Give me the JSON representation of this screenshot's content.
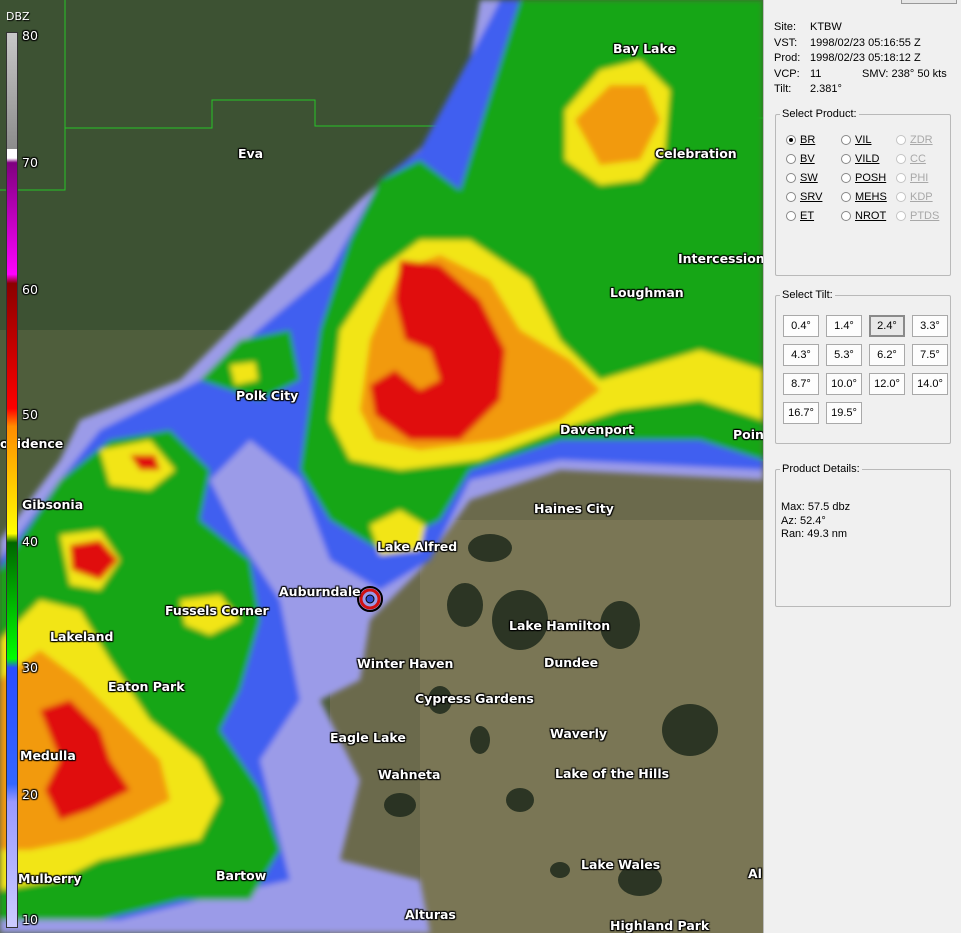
{
  "map": {
    "cities": [
      {
        "name": "Bay Lake"
      },
      {
        "name": "Eva"
      },
      {
        "name": "Celebration"
      },
      {
        "name": "Intercession C"
      },
      {
        "name": "Loughman"
      },
      {
        "name": "Polk City"
      },
      {
        "name": "Davenport"
      },
      {
        "name": "Poin"
      },
      {
        "name": "ovidence"
      },
      {
        "name": "Gibsonia"
      },
      {
        "name": "Haines City"
      },
      {
        "name": "Lake Alfred"
      },
      {
        "name": "Auburndale"
      },
      {
        "name": "Fussels Corner"
      },
      {
        "name": "Lake Hamilton"
      },
      {
        "name": "Lakeland"
      },
      {
        "name": "Winter Haven"
      },
      {
        "name": "Dundee"
      },
      {
        "name": "Eaton Park"
      },
      {
        "name": "Cypress Gardens"
      },
      {
        "name": "Waverly"
      },
      {
        "name": "Eagle Lake"
      },
      {
        "name": "Medulla"
      },
      {
        "name": "Wahneta"
      },
      {
        "name": "Lake of the Hills"
      },
      {
        "name": "Lake Wales"
      },
      {
        "name": "Al"
      },
      {
        "name": "Mulberry"
      },
      {
        "name": "Bartow"
      },
      {
        "name": "Alturas"
      },
      {
        "name": "Highland Park"
      }
    ]
  },
  "scale": {
    "title": "DBZ",
    "ticks": [
      "80",
      "70",
      "60",
      "50",
      "40",
      "30",
      "20",
      "10"
    ],
    "colors": [
      "#ffffff",
      "#9c9c9c",
      "#7f007f",
      "#ff00ff",
      "#8b0000",
      "#ff0000",
      "#ff8c00",
      "#ffff00",
      "#008800",
      "#00ff00",
      "#3355ff",
      "#9999ff"
    ]
  },
  "info": {
    "site_label": "Site:",
    "site": "KTBW",
    "vst_label": "VST:",
    "vst": "1998/02/23  05:16:55 Z",
    "prod_label": "Prod:",
    "prod": "1998/02/23  05:18:12 Z",
    "vcp_label": "VCP:",
    "vcp": "11",
    "smv": "SMV: 238° 50 kts",
    "tilt_label": "Tilt:",
    "tilt": "2.381°"
  },
  "products": {
    "legend": "Select Product:",
    "items": [
      {
        "label": "BR",
        "selected": true,
        "enabled": true
      },
      {
        "label": "VIL",
        "enabled": true
      },
      {
        "label": "ZDR",
        "enabled": false
      },
      {
        "label": "BV",
        "enabled": true
      },
      {
        "label": "VILD",
        "enabled": true
      },
      {
        "label": "CC",
        "enabled": false
      },
      {
        "label": "SW",
        "enabled": true
      },
      {
        "label": "POSH",
        "enabled": true
      },
      {
        "label": "PHI",
        "enabled": false
      },
      {
        "label": "SRV",
        "enabled": true
      },
      {
        "label": "MEHS",
        "enabled": true
      },
      {
        "label": "KDP",
        "enabled": false
      },
      {
        "label": "ET",
        "enabled": true
      },
      {
        "label": "NROT",
        "enabled": true
      },
      {
        "label": "PTDS",
        "enabled": false
      }
    ]
  },
  "tilts": {
    "legend": "Select Tilt:",
    "items": [
      "0.4°",
      "1.4°",
      "2.4°",
      "3.3°",
      "4.3°",
      "5.3°",
      "6.2°",
      "7.5°",
      "8.7°",
      "10.0°",
      "12.0°",
      "14.0°",
      "16.7°",
      "19.5°"
    ],
    "selected": "2.4°"
  },
  "details": {
    "legend": "Product Details:",
    "max": "Max:  57.5 dbz",
    "az": "Az:   52.4°",
    "ran": "Ran:  49.3 nm"
  }
}
